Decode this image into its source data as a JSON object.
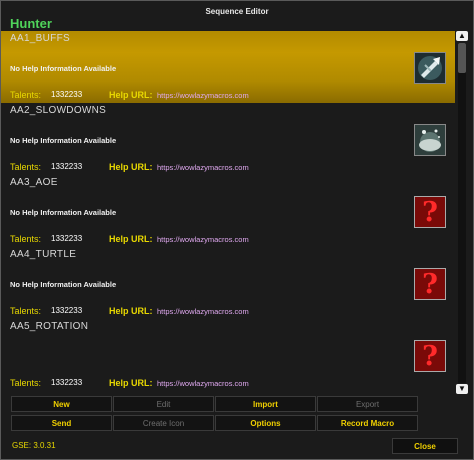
{
  "window": {
    "title": "Sequence Editor"
  },
  "class_name": "Hunter",
  "entries": [
    {
      "name": "AA1_BUFFS",
      "help": "No Help Information Available",
      "talents_label": "Talents:",
      "talents": "1332233",
      "help_url_label": "Help URL:",
      "help_url": "https://wowlazymacros.com",
      "icon": "aspect-icon",
      "selected": true
    },
    {
      "name": "AA2_SLOWDOWNS",
      "help": "No Help Information Available",
      "talents_label": "Talents:",
      "talents": "1332233",
      "help_url_label": "Help URL:",
      "help_url": "https://wowlazymacros.com",
      "icon": "tracking-icon",
      "selected": false
    },
    {
      "name": "AA3_AOE",
      "help": "No Help Information Available",
      "talents_label": "Talents:",
      "talents": "1332233",
      "help_url_label": "Help URL:",
      "help_url": "https://wowlazymacros.com",
      "icon": "question-mark-icon",
      "selected": false
    },
    {
      "name": "AA4_TURTLE",
      "help": "No Help Information Available",
      "talents_label": "Talents:",
      "talents": "1332233",
      "help_url_label": "Help URL:",
      "help_url": "https://wowlazymacros.com",
      "icon": "question-mark-icon",
      "selected": false
    },
    {
      "name": "AA5_ROTATION",
      "help": "",
      "talents_label": "Talents:",
      "talents": "1332233",
      "help_url_label": "Help URL:",
      "help_url": "https://wowlazymacros.com",
      "icon": "question-mark-icon",
      "selected": false
    }
  ],
  "buttons": {
    "new": "New",
    "edit": "Edit",
    "import": "Import",
    "export": "Export",
    "send": "Send",
    "create_icon": "Create Icon",
    "options": "Options",
    "record_macro": "Record Macro",
    "close": "Close"
  },
  "version": "GSE: 3.0.31",
  "scroll": {
    "up_icon": "▲",
    "down_icon": "▼"
  },
  "question_glyph": "?",
  "colors": {
    "accent": "#f0d000",
    "class": "#4fd35a",
    "selected": "#c59900",
    "url": "#e0a9f0"
  }
}
